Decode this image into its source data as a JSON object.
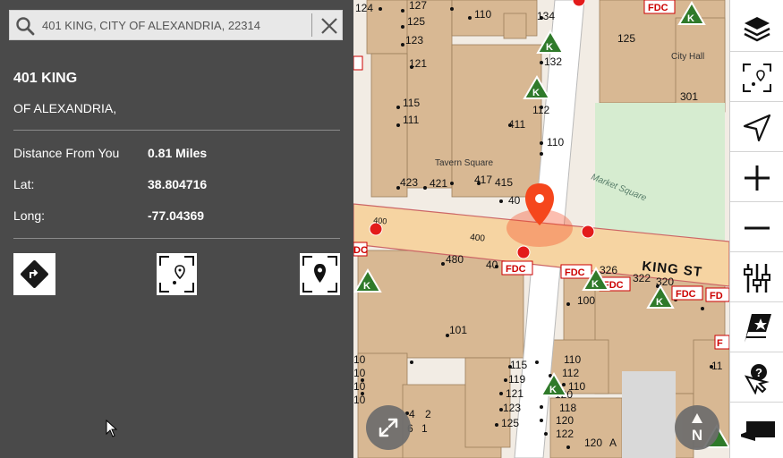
{
  "search": {
    "value": "401 KING, CITY OF ALEXANDRIA, 22314"
  },
  "result": {
    "title": "401 KING",
    "subtitle": "OF ALEXANDRIA,",
    "rows": [
      {
        "label": "Distance From You",
        "value": "0.81 Miles"
      },
      {
        "label": "Lat:",
        "value": "38.804716"
      },
      {
        "label": "Long:",
        "value": "-77.04369"
      }
    ]
  },
  "map": {
    "streets": [
      {
        "name": "KING ST"
      },
      {
        "name": "400"
      },
      {
        "name": "400"
      }
    ],
    "places": [
      {
        "name": "Tavern Square"
      },
      {
        "name": "Market Square"
      },
      {
        "name": "City Hall"
      }
    ],
    "addresses": [
      "124",
      "127",
      "125",
      "123",
      "121",
      "115",
      "111",
      "110",
      "134",
      "132",
      "112",
      "411",
      "110",
      "423",
      "421",
      "417",
      "415",
      "40",
      "125",
      "301",
      "480",
      "40",
      "326",
      "322",
      "320",
      "100",
      "101",
      "110",
      "112",
      "110",
      "115",
      "119",
      "121",
      "123",
      "125",
      "120",
      "118",
      "120",
      "122",
      "120",
      "122",
      "A",
      "10",
      "10",
      "10",
      "10",
      "4",
      "3",
      "2",
      "1",
      "6",
      "11",
      "1"
    ],
    "fdc_label": "FDC",
    "k_label": "K",
    "colors": {
      "building": "#d8b893",
      "road": "#f6d4a2",
      "park": "#d6ecd0",
      "marker": "#f5461c",
      "dot": "#e31b1b",
      "k_badge": "#2f7a2a",
      "panel": "#4a4a4a"
    }
  },
  "controls": {
    "north_label": "N",
    "toolbar": [
      "layers-icon",
      "locate-icon",
      "navigate-icon",
      "zoom-in-icon",
      "zoom-out-icon",
      "filter-icon",
      "favorites-icon",
      "help-icon",
      "basemap-icon"
    ]
  }
}
